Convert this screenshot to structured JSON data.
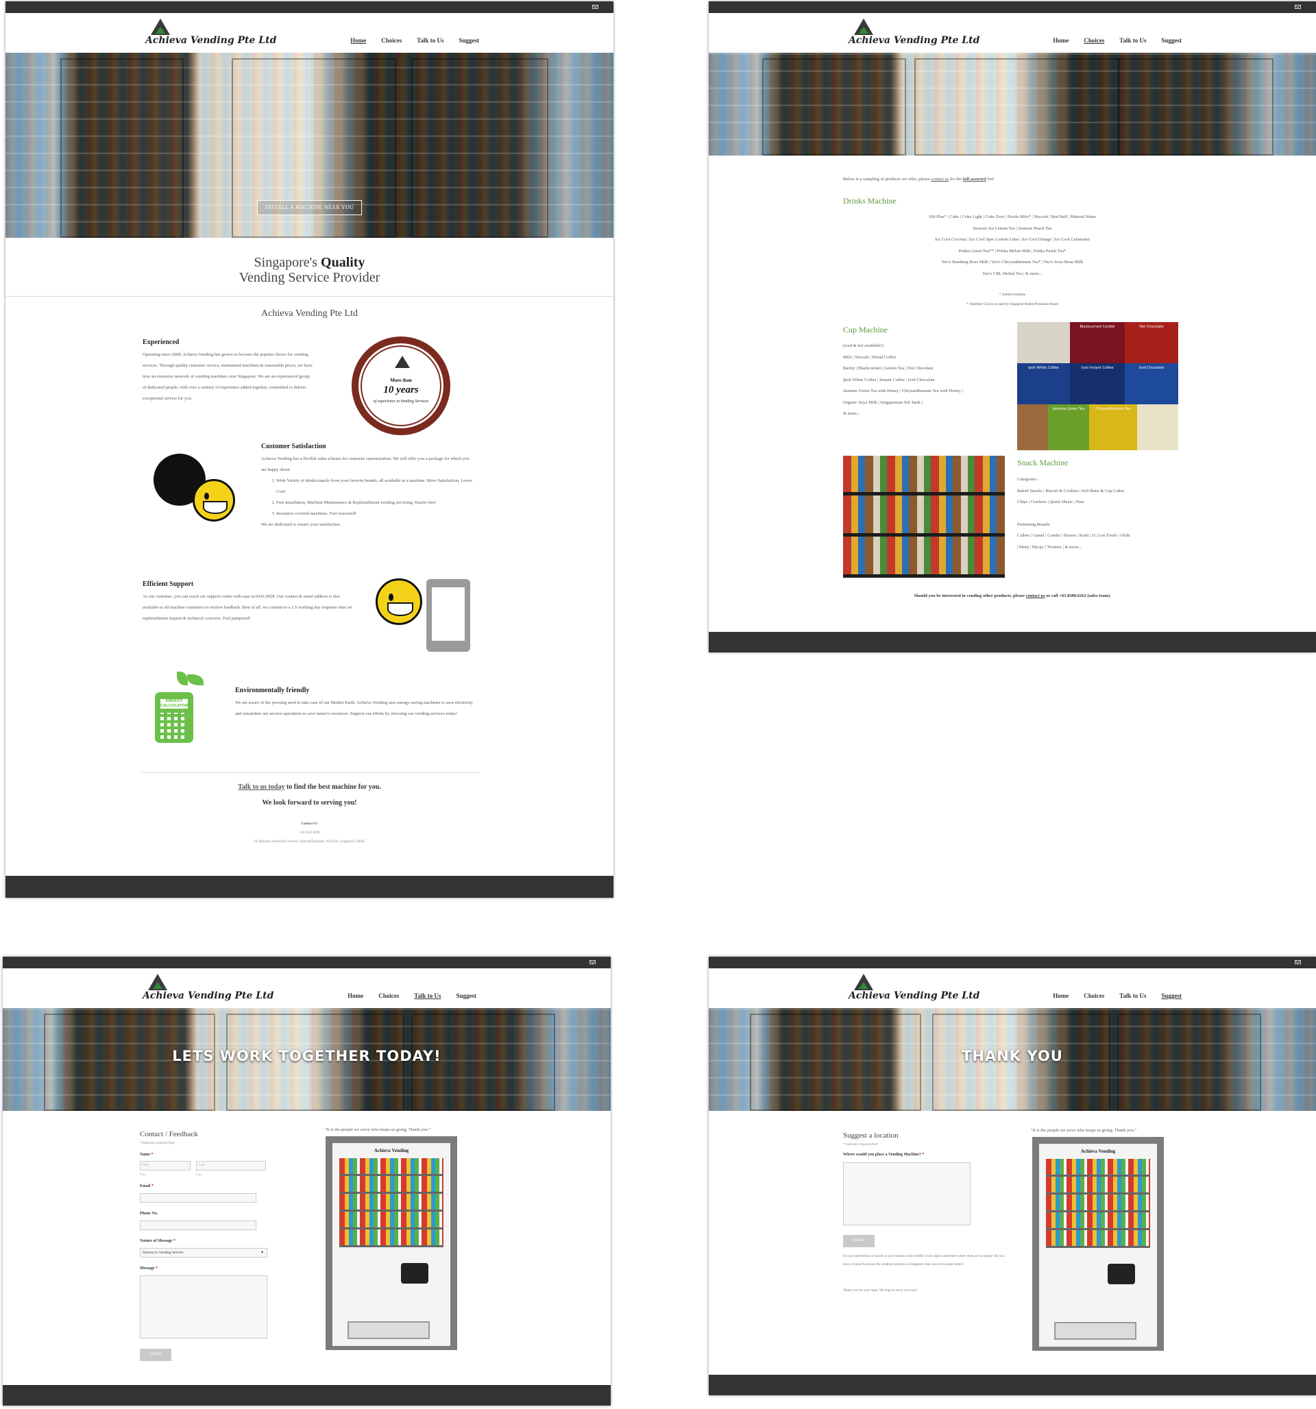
{
  "site": {
    "brand": "Achieva Vending Pte Ltd",
    "nav": [
      "Home",
      "Choices",
      "Talk to Us",
      "Suggest"
    ]
  },
  "home": {
    "hero_button": "INSTALL A MACHINE NEAR YOU",
    "tagline_pre": "Singapore's",
    "tagline_bold": "Quality",
    "tagline_line2": "Vending Service Provider",
    "company": "Achieva Vending Pte Ltd",
    "badge": {
      "line1": "More than",
      "line2": "10 years",
      "line3": "of experience in Vending Services"
    },
    "features": [
      {
        "title": "Experienced",
        "body": "Operating since 2008, Achieva Vending has grown to become the popular choice for vending services. Through quality customer service, maintained machines & reasonable prices, we have now an extensive network of vending machines over Singapore. We are an experienced group of dedicated people, with over a century of experience added together, committed to deliver exceptional service for you."
      },
      {
        "title": "Customer Satisfaction",
        "body": "Achieva Vending has a flexible sales scheme for customer customization. We will offer you a package for which you are happy about.",
        "list": [
          "Wide Variety of drinks/snacks from your favorite brands, all available in a machine. More Satisfaction, Lower Cost!",
          "Free installation, Machine Maintenance & Replenishment vending servicing. Hassle-free!",
          "Insurance-covered machines. Feel reassured!"
        ],
        "footer": "We are dedicated to ensure your satisfaction."
      },
      {
        "title": "Efficient Support",
        "body": "As our customer, you can reach our support centre with ease at 6542.0028. Our contact & email address is also available to all machine customers to receive feedback. Best of all, we commit to a 1.5 working day response time on replenishment request & technical concerns. Feel pampered!"
      },
      {
        "title": "Environmentally friendly",
        "body": "We are aware of the pressing need to take care of our Mother Earth. Achieva Vending uses energy-saving machines to save electricity and streamline our service operations to save nature's resources. Support our efforts by choosing our vending services today!"
      }
    ],
    "energy_label": "ENERGY CALCULATOR",
    "cta_link": "Talk to us today",
    "cta_rest": " to find the best machine for you.",
    "cta_line2": "We look forward to serving you!",
    "contact_title": "Contact Us",
    "contact_phone": "+65 6542 0028",
    "contact_address": "18 Tampines Industrial Crescent, Space@Tampines, #03-05A, Singapore 528605"
  },
  "choices": {
    "intro_pre": "Below is a sampling of products we offer, please",
    "intro_link": "contact us",
    "intro_mid": "for the",
    "intro_bold": "full assorted",
    "intro_post": "list!",
    "drinks_title": "Drinks Machine",
    "drinks_lines": [
      "100 Plus* | Coke | Coke Light | Coke Zero | Nestle Milo* | Nescafe | Red Bull | Mineral Water",
      "Seasons Ice Lemon Tea | Seasons Peach Tea",
      "Ice Cool Coconut | Ice Cool Spec Lemon Lime | Ice Cool Orange | Ice Cool Calamansi",
      "Pokka Green Tea** | Pokka Melon Milk | Pokka Peach Tea*",
      "Yeo's Bandung Rose Milk | Yeo's Chrysanthemum Tea* | Yeo's Soya Bean Milk",
      "Yeo's CBL Herbal Tea | & more..."
    ],
    "drinks_note1": "*: bottled available",
    "drinks_note2": "*: Healthier Choice as rated by Singapore Health Promotion Board",
    "cup_title": "Cup Machine",
    "cup_lines": [
      "(iced & hot available!)",
      "Milo | Nescafe | Blend Coffee",
      "Barley | Blackcurrant | Lemon Tea | Hot Chocolate",
      "Ipoh White Coffee | Instant Coffee | Iced Chocolate",
      "Jasmine Green Tea with Honey | Chrysanthemum Tea with Honey |",
      "Organic Soya Milk | Singaporean Teh Tarik |",
      "& more..."
    ],
    "cup_tiles": [
      "",
      "Blackcurrant Cordial",
      "Hot Chocolate",
      "Ipoh White Coffee",
      "Iced Instant Coffee",
      "Iced Chocolate",
      "",
      "Jasmine Green Tea",
      "Chrysanthemum Tea",
      ""
    ],
    "snack_title": "Snack Machine",
    "snack_lines": [
      "Categories :",
      "Baked Snacks | Biscuit & Cookies | Soft Buns & Cup Cakes",
      "Chips | Crackers | Quick Meals | Nuts",
      "",
      "Partnering Brands:",
      "Calbee | Camel | Combo | Hosten | Kraft | JJ | Lee Foods | Oishi",
      "| Meiji | Myojo | Twisties | & more..."
    ],
    "bottom_pre": "Should you be interested in vending other products, please",
    "bottom_link": "contact us",
    "bottom_post": "or call +65.8388.6262 (sales team)."
  },
  "talk": {
    "hero_title": "LETS WORK TOGETHER TODAY!",
    "form_title": "Contact / Feedback",
    "req_note": "* Indicates required field",
    "name_label": "Name",
    "first_ph": "First",
    "last_ph": "Last",
    "first_sub": "First",
    "last_sub": "Last",
    "email_label": "Email",
    "phone_label": "Phone No.",
    "nature_label": "Nature of Message",
    "nature_value": "Interest in Vending Service",
    "message_label": "Message",
    "submit": "SUBMIT",
    "quote": "\"It is the people we serve who keeps us going. Thank you.\"",
    "vend_brand": "Achieva Vending"
  },
  "suggest": {
    "hero_title": "THANK YOU",
    "form_title": "Suggest a location",
    "req_note": "* Indicates required field",
    "where_label": "Where would you place a Vending Machine?",
    "submit": "SUBMIT",
    "note1": "Do you need drinks or snacks at any location in the middle of the night somewhere where there are no shops? Do you know of good locations for vending machines in Singapore that can serve people better?",
    "note2": "Thank you for your input. We hope to serve you soon!",
    "quote": "\"It is the people we serve who keeps us going. Thank you.\"",
    "vend_brand": "Achieva Vending"
  }
}
